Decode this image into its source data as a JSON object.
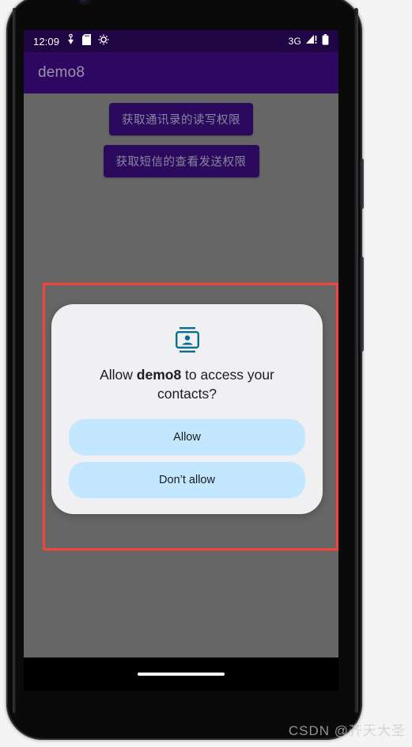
{
  "colors": {
    "status_bar_bg": "#200544",
    "app_bar_bg": "#2e0763",
    "scrim_bg": "#666666",
    "dialog_bg": "#f0f0f2",
    "dialog_button_bg": "#c2e7ff",
    "dialog_icon": "#0c6e8f",
    "annotation_red": "#f4423c",
    "perm_button_bg": "#2b0a5e"
  },
  "status_bar": {
    "clock": "12:09",
    "left_icons": [
      "usb-debug-icon",
      "sd-card-icon",
      "gear-icon"
    ],
    "network_type": "3G",
    "right_icons": [
      "signal-warning-icon",
      "battery-icon"
    ]
  },
  "app_bar": {
    "title": "demo8"
  },
  "app_content": {
    "buttons": [
      {
        "label": "获取通讯录的读写权限"
      },
      {
        "label": "获取短信的查看发送权限"
      }
    ]
  },
  "dialog": {
    "icon": "contacts-card-icon",
    "message_prefix": "Allow ",
    "app_name": "demo8",
    "message_suffix": " to access your contacts?",
    "buttons": [
      {
        "label": "Allow",
        "name": "allow-button"
      },
      {
        "label": "Don’t allow",
        "name": "dont-allow-button"
      }
    ]
  },
  "gesture_nav": {
    "pill": "home-gesture-pill"
  },
  "watermark": {
    "text": "CSDN @齐天大圣"
  }
}
